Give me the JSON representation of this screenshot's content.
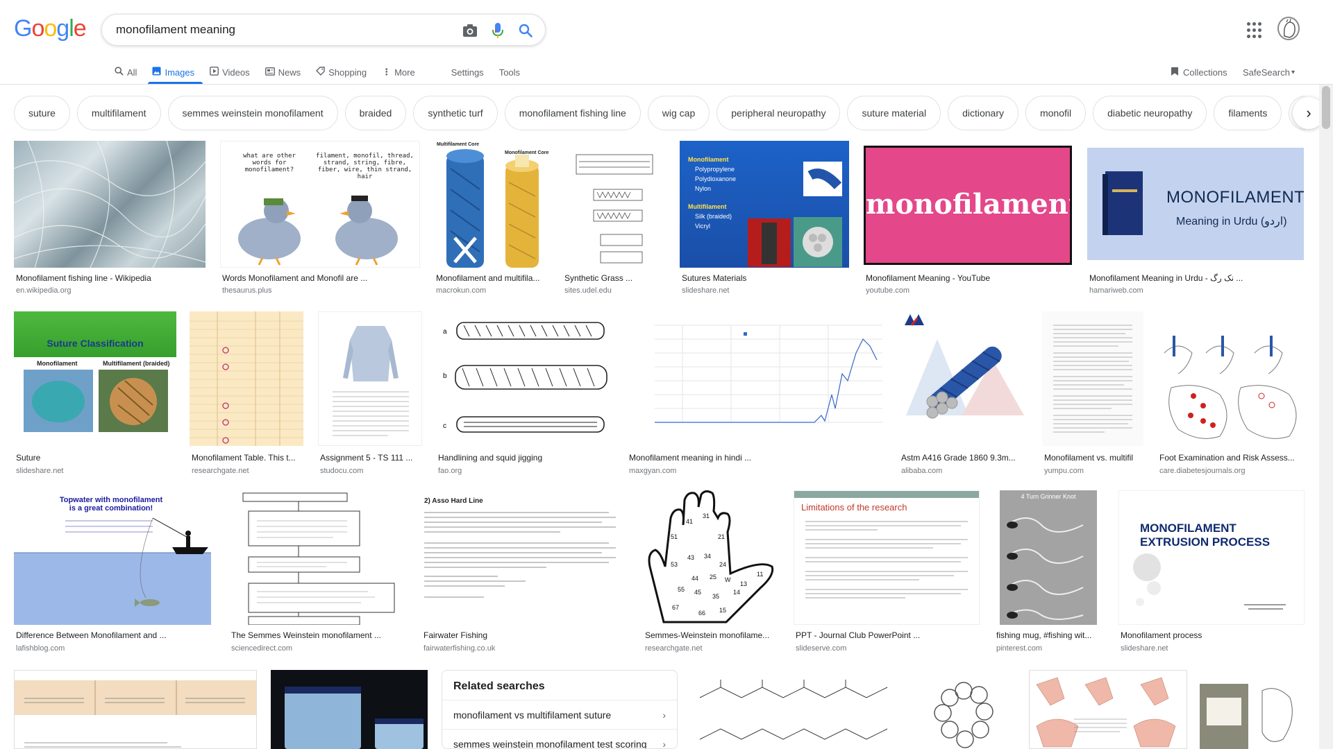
{
  "search": {
    "query": "monofilament meaning"
  },
  "logo": [
    "G",
    "o",
    "o",
    "g",
    "l",
    "e"
  ],
  "tabs": [
    {
      "label": "All",
      "icon": "search-icon"
    },
    {
      "label": "Images",
      "icon": "image-icon"
    },
    {
      "label": "Videos",
      "icon": "video-icon"
    },
    {
      "label": "News",
      "icon": "news-icon"
    },
    {
      "label": "Shopping",
      "icon": "tag-icon"
    },
    {
      "label": "More",
      "icon": "kebab-icon"
    }
  ],
  "tools": {
    "settings": "Settings",
    "tools": "Tools",
    "collections": "Collections",
    "safesearch": "SafeSearch"
  },
  "chips": [
    "suture",
    "multifilament",
    "semmes weinstein monofilament",
    "braided",
    "synthetic turf",
    "monofilament fishing line",
    "wig cap",
    "peripheral neuropathy",
    "suture material",
    "dictionary",
    "monofil",
    "diabetic neuropathy",
    "filaments",
    "fu"
  ],
  "results": [
    {
      "title": "Monofilament fishing line - Wikipedia",
      "source": "en.wikipedia.org"
    },
    {
      "title": "Words Monofilament and Monofil are ...",
      "source": "thesaurus.plus"
    },
    {
      "title": "Monofilament and multifila...",
      "source": "macrokun.com"
    },
    {
      "title": "Synthetic Grass ...",
      "source": "sites.udel.edu"
    },
    {
      "title": "Sutures Materials",
      "source": "slideshare.net"
    },
    {
      "title": "Monofilament Meaning - YouTube",
      "source": "youtube.com"
    },
    {
      "title": "Monofilament Meaning in Urdu - نک رگ ...",
      "source": "hamariweb.com"
    },
    {
      "title": "Suture",
      "source": "slideshare.net"
    },
    {
      "title": "Monofilament Table. This t...",
      "source": "researchgate.net"
    },
    {
      "title": "Assignment 5 - TS 111 ...",
      "source": "studocu.com"
    },
    {
      "title": "Handlining and squid jigging",
      "source": "fao.org"
    },
    {
      "title": "Monofilament meaning in hindi ...",
      "source": "maxgyan.com"
    },
    {
      "title": "Astm A416 Grade 1860 9.3m...",
      "source": "alibaba.com"
    },
    {
      "title": "Monofilament vs. multifil",
      "source": "yumpu.com"
    },
    {
      "title": "Foot Examination and Risk Assess...",
      "source": "care.diabetesjournals.org"
    },
    {
      "title": "Difference Between Monofilament and ...",
      "source": "lafishblog.com"
    },
    {
      "title": "The Semmes Weinstein monofilament ...",
      "source": "sciencedirect.com"
    },
    {
      "title": "Fairwater Fishing",
      "source": "fairwaterfishing.co.uk"
    },
    {
      "title": "Semmes-Weinstein monofilame...",
      "source": "researchgate.net"
    },
    {
      "title": "PPT - Journal Club PowerPoint ...",
      "source": "slideserve.com"
    },
    {
      "title": "fishing mug, #fishing wit...",
      "source": "pinterest.com"
    },
    {
      "title": "Monofilament process",
      "source": "slideshare.net"
    }
  ],
  "thumb_text": {
    "monofilament_banner": "monofilament",
    "urdu_title": "MONOFILAMENT",
    "urdu_sub": "Meaning in Urdu (اردو)",
    "suture_title": "Suture Classification",
    "suture_mono": "Monofilament",
    "suture_multi": "Multifilament (braided)",
    "sutures_list": [
      "Monofilament",
      "Polypropylene",
      "Polydioxanone",
      "Nylon",
      "Multifilament",
      "Silk (braided)",
      "Vicryl"
    ],
    "thesaurus_q": "what are other words for monofilament?",
    "thesaurus_a": "filament, monofil, thread, strand, string, fibre, fiber, wire, thin strand, hair",
    "topwater": "Topwater with monofilament is a great combination!",
    "asso_title": "2) Asso Hard Line",
    "limitations": "Limitations of the research",
    "knot": "4 Turn Grinner Knot",
    "extrusion": "MONOFILAMENT EXTRUSION PROCESS",
    "multi_core": "Multifilament Core",
    "mono_core": "Monofilament Core"
  },
  "related": {
    "title": "Related searches",
    "items": [
      "monofilament vs multifilament suture",
      "semmes weinstein monofilament test scoring"
    ]
  }
}
